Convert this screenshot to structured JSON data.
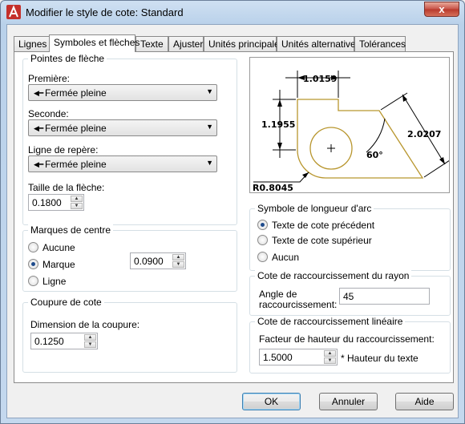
{
  "window": {
    "title": "Modifier le style de cote: Standard",
    "close_glyph": "x"
  },
  "tabs": [
    {
      "label": "Lignes"
    },
    {
      "label": "Symboles et flèches",
      "active": true
    },
    {
      "label": "Texte"
    },
    {
      "label": "Ajuster"
    },
    {
      "label": "Unités principales"
    },
    {
      "label": "Unités alternatives"
    },
    {
      "label": "Tolérances"
    }
  ],
  "arrowheads": {
    "title": "Pointes de flèche",
    "first_label": "Première:",
    "first_value": "Fermée pleine",
    "second_label": "Seconde:",
    "second_value": "Fermée pleine",
    "leader_label": "Ligne de repère:",
    "leader_value": "Fermée pleine",
    "size_label": "Taille de la flèche:",
    "size_value": "0.1800"
  },
  "center_marks": {
    "title": "Marques de centre",
    "options": [
      "Aucune",
      "Marque",
      "Ligne"
    ],
    "selected": "Marque",
    "size_value": "0.0900"
  },
  "dimension_break": {
    "title": "Coupure de cote",
    "size_label": "Dimension de la coupure:",
    "size_value": "0.1250"
  },
  "preview": {
    "dim_top": "1.0159",
    "dim_left": "1.1955",
    "dim_right": "2.0207",
    "angle": "60°",
    "radius": "R0.8045"
  },
  "arc_length": {
    "title": "Symbole de longueur d'arc",
    "options": [
      "Texte de cote précédent",
      "Texte de cote supérieur",
      "Aucun"
    ],
    "selected": "Texte de cote précédent"
  },
  "radius_jog": {
    "title": "Cote de raccourcissement du rayon",
    "angle_label_1": "Angle de",
    "angle_label_2": "raccourcissement:",
    "angle_value": "45"
  },
  "linear_jog": {
    "title": "Cote de raccourcissement linéaire",
    "factor_label": "Facteur de hauteur du raccourcissement:",
    "factor_value": "1.5000",
    "suffix": "* Hauteur du texte"
  },
  "buttons": {
    "ok": "OK",
    "cancel": "Annuler",
    "help": "Aide"
  },
  "colors": {
    "preview_outline": "#b8962e",
    "title_bar": "#b9d1ea",
    "close_button": "#c75146"
  }
}
